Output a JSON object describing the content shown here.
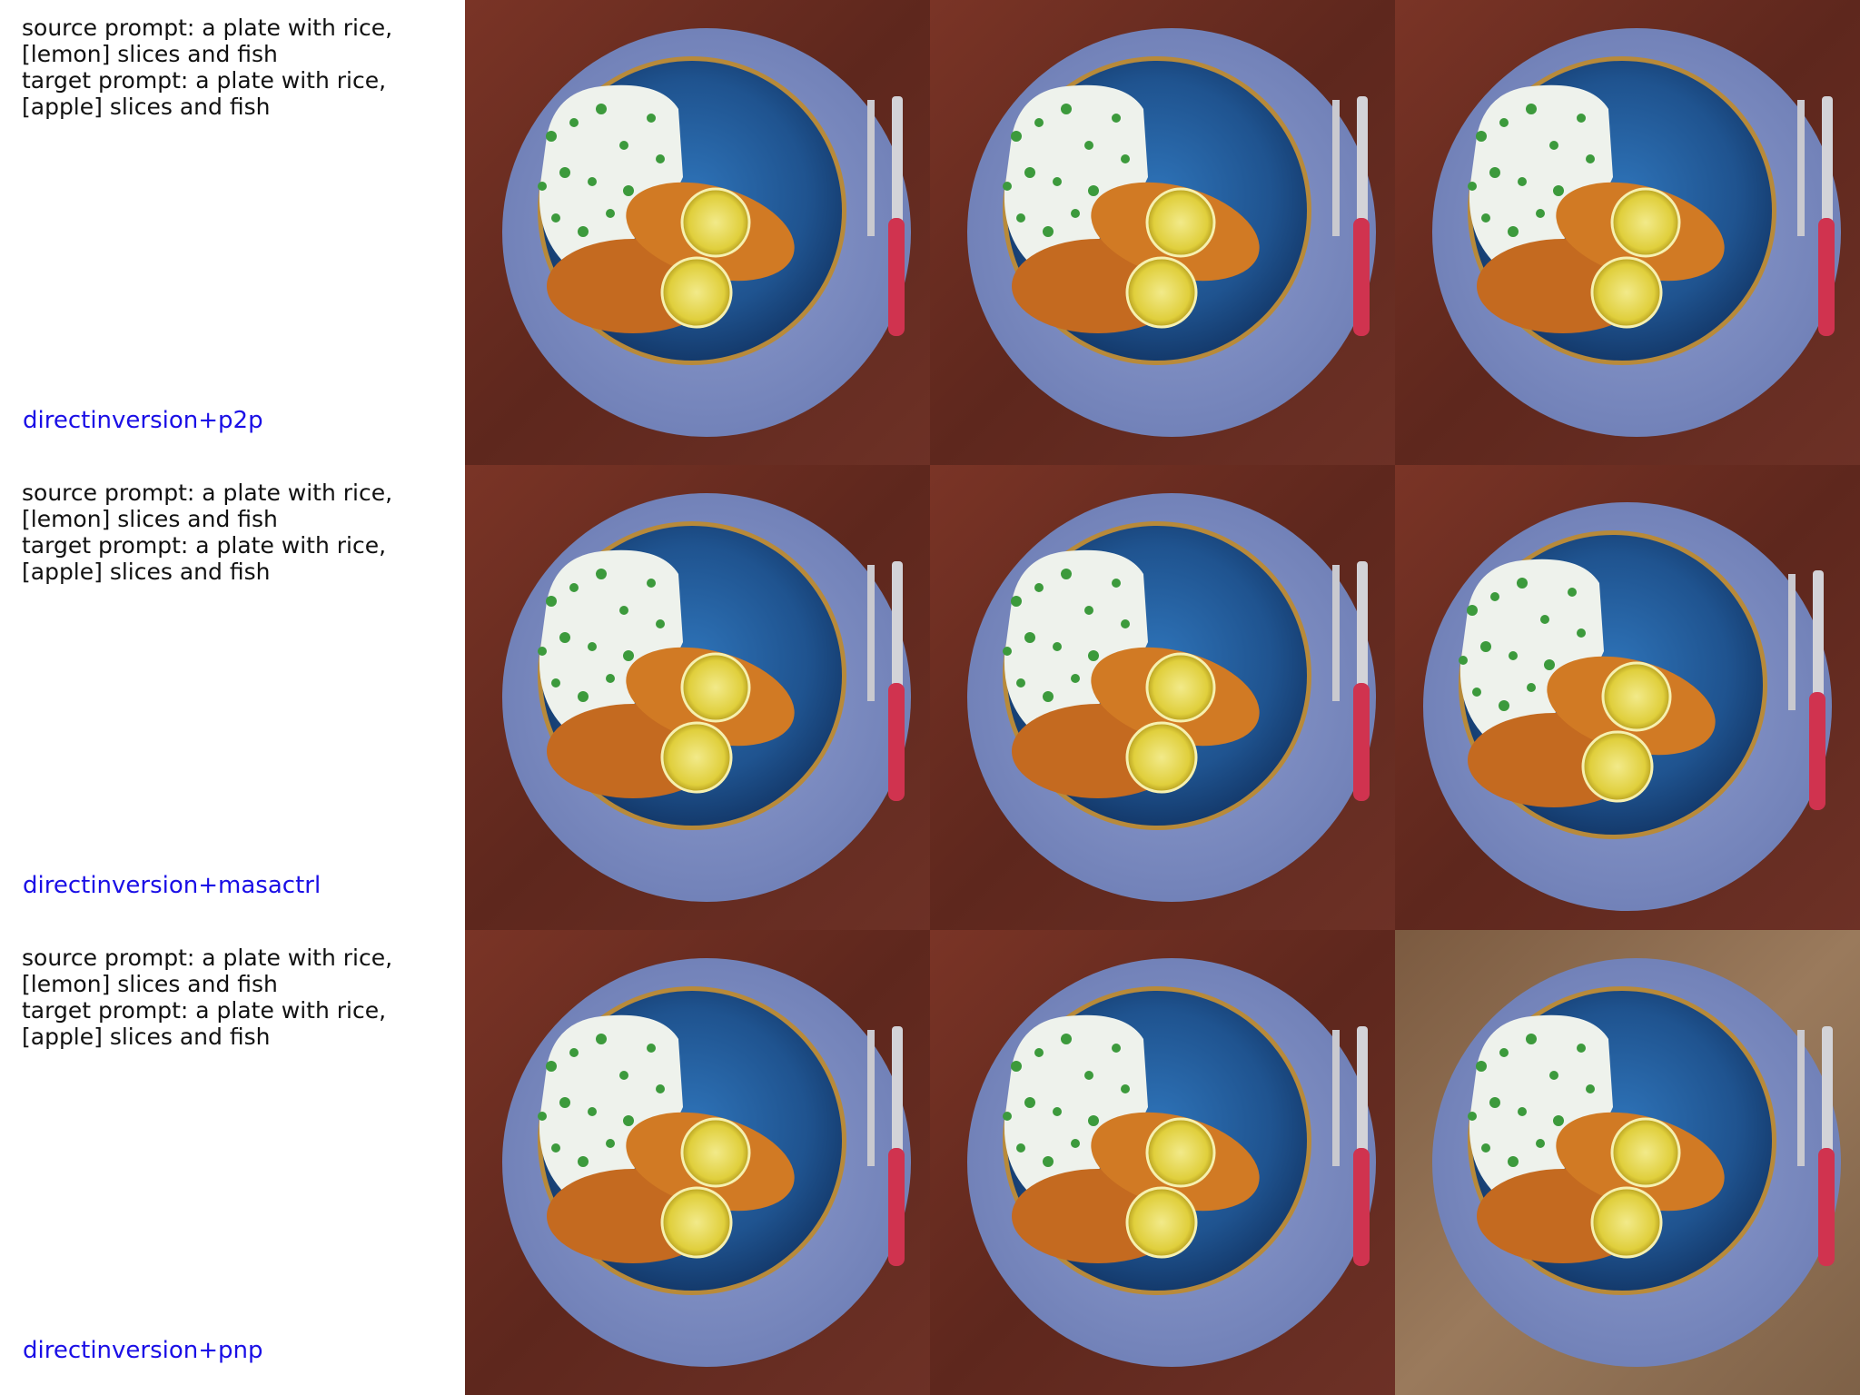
{
  "rows": [
    {
      "source_prompt": "source prompt: a plate with rice,\n[lemon] slices and fish",
      "target_prompt": "target prompt: a plate with rice,\n[apple] slices and fish",
      "method": "directinversion+p2p"
    },
    {
      "source_prompt": "source prompt: a plate with rice,\n[lemon] slices and fish",
      "target_prompt": "target prompt: a plate with rice,\n[apple] slices and fish",
      "method": "directinversion+masactrl"
    },
    {
      "source_prompt": "source prompt: a plate with rice,\n[lemon] slices and fish",
      "target_prompt": "target prompt: a plate with rice,\n[apple] slices and fish",
      "method": "directinversion+pnp"
    }
  ],
  "colors": {
    "method_label": "#1a0ee6",
    "table_wood": "#6e2e22",
    "placemat": "#7f8fc4",
    "plate": "#1f4f8e",
    "fish": "#c9701e",
    "lemon": "#e6d94a",
    "knife_handle": "#d0334f",
    "light_wood": "#8a6a4f"
  }
}
